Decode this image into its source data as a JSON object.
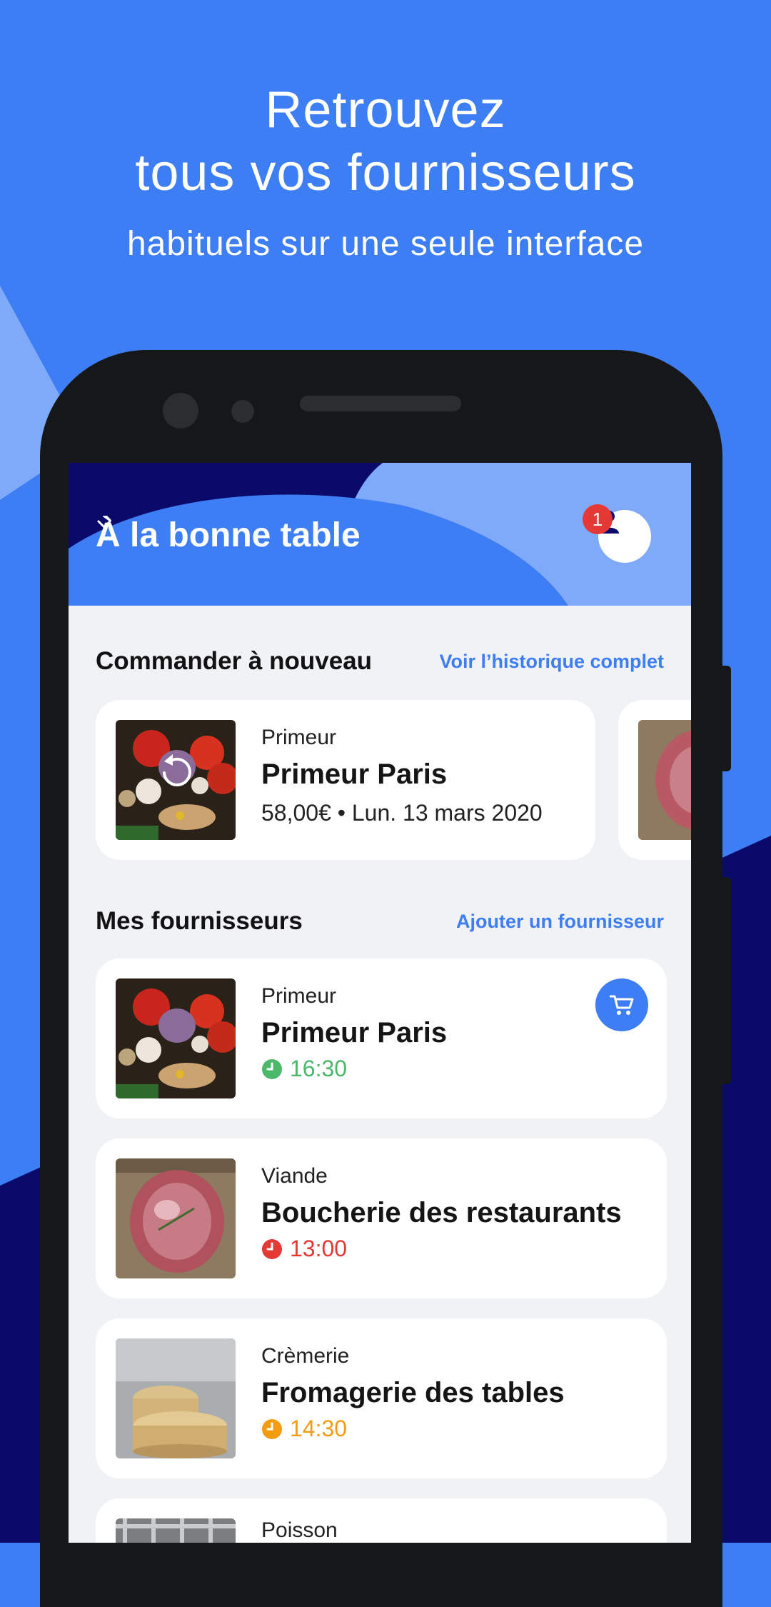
{
  "hero": {
    "title_line1": "Retrouvez",
    "title_line2": "tous vos fournisseurs",
    "subtitle": "habituels sur une seule interface"
  },
  "header": {
    "store_name": "À la bonne table",
    "notification_count": "1",
    "icons": {
      "dropdown": "chevron-down-icon",
      "account": "user-icon"
    }
  },
  "reorder": {
    "title": "Commander à nouveau",
    "link": "Voir l’historique complet",
    "cards": [
      {
        "category": "Primeur",
        "name": "Primeur Paris",
        "meta": "58,00€ • Lun. 13 mars 2020",
        "image": "vegetables-photo",
        "icon": "reorder-arrow-icon"
      },
      {
        "image": "meat-photo"
      }
    ]
  },
  "suppliers": {
    "title": "Mes fournisseurs",
    "link": "Ajouter un fournisseur",
    "items": [
      {
        "category": "Primeur",
        "name": "Primeur Paris",
        "time": "16:30",
        "color": "#4cb86a",
        "image": "vegetables-photo",
        "has_cart": true
      },
      {
        "category": "Viande",
        "name": "Boucherie des restaurants",
        "time": "13:00",
        "color": "#e53935",
        "image": "meat-photo"
      },
      {
        "category": "Crèmerie",
        "name": "Fromagerie des tables",
        "time": "14:30",
        "color": "#f39c12",
        "image": "cheese-photo"
      },
      {
        "category": "Poisson",
        "image": "fish-photo"
      }
    ]
  },
  "colors": {
    "primary": "#3d7ef5",
    "navy": "#0a0a6b",
    "light_blue": "#7fa9f9"
  }
}
